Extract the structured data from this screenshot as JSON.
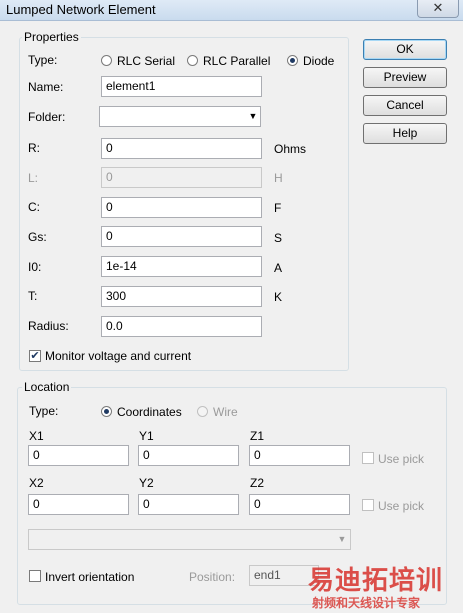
{
  "window": {
    "title": "Lumped Network Element",
    "close_glyph": "✕"
  },
  "properties": {
    "group_label": "Properties",
    "type": {
      "label": "Type:",
      "options": [
        "RLC Serial",
        "RLC Parallel",
        "Diode"
      ],
      "selected": "Diode"
    },
    "name": {
      "label": "Name:",
      "value": "element1"
    },
    "folder": {
      "label": "Folder:",
      "value": ""
    },
    "r": {
      "label": "R:",
      "value": "0",
      "unit": "Ohms"
    },
    "l": {
      "label": "L:",
      "value": "0",
      "unit": "H",
      "enabled": false
    },
    "c": {
      "label": "C:",
      "value": "0",
      "unit": "F"
    },
    "gs": {
      "label": "Gs:",
      "value": "0",
      "unit": "S"
    },
    "i0": {
      "label": "I0:",
      "value": "1e-14",
      "unit": "A"
    },
    "t": {
      "label": "T:",
      "value": "300",
      "unit": "K"
    },
    "radius": {
      "label": "Radius:",
      "value": "0.0"
    },
    "monitor": {
      "label": "Monitor voltage and current",
      "checked": true
    }
  },
  "buttons": {
    "ok": "OK",
    "preview": "Preview",
    "cancel": "Cancel",
    "help": "Help"
  },
  "location": {
    "group_label": "Location",
    "type_label": "Type:",
    "coordinates_label": "Coordinates",
    "wire_label": "Wire",
    "selected": "Coordinates",
    "p1": {
      "x_label": "X1",
      "y_label": "Y1",
      "z_label": "Z1",
      "x": "0",
      "y": "0",
      "z": "0",
      "use_pick": "Use pick"
    },
    "p2": {
      "x_label": "X2",
      "y_label": "Y2",
      "z_label": "Z2",
      "x": "0",
      "y": "0",
      "z": "0",
      "use_pick": "Use pick"
    },
    "wire_select": {
      "value": ""
    },
    "invert": {
      "label": "Invert orientation",
      "checked": false
    },
    "position": {
      "label": "Position:",
      "value": "end1"
    }
  },
  "watermark": {
    "main": "易迪拓培训",
    "sub": "射频和天线设计专家"
  },
  "colors": {
    "title_bar": "#c9dbee",
    "dialog_bg": "#f0f0f0",
    "disabled_text": "#9a9a9a",
    "watermark_red": "#d8322c"
  }
}
